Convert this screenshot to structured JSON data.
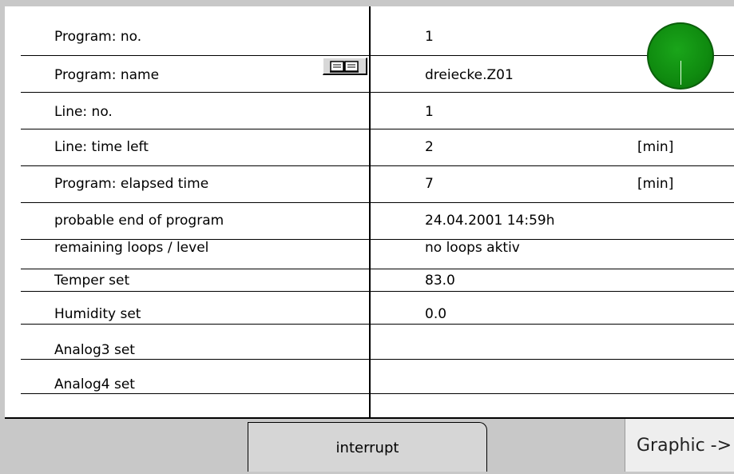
{
  "rows": [
    {
      "label": "Program: no.",
      "value": "1",
      "unit": ""
    },
    {
      "label": "Program: name",
      "value": "dreiecke.Z01",
      "unit": ""
    },
    {
      "label": "Line: no.",
      "value": "1",
      "unit": ""
    },
    {
      "label": "Line: time left",
      "value": "2",
      "unit": "[min]"
    },
    {
      "label": "Program: elapsed time",
      "value": "7",
      "unit": "[min]"
    },
    {
      "label": "probable end of program",
      "value": "24.04.2001 14:59h",
      "unit": ""
    },
    {
      "label": "remaining loops / level",
      "value": "no loops aktiv",
      "unit": ""
    },
    {
      "label": "Temper set",
      "value": "83.0",
      "unit": ""
    },
    {
      "label": "Humidity set",
      "value": "0.0",
      "unit": ""
    },
    {
      "label": "Analog3 set",
      "value": "",
      "unit": ""
    },
    {
      "label": "Analog4 set",
      "value": "",
      "unit": ""
    }
  ],
  "status_indicator": {
    "color": "#109010",
    "icon": "clock-status-icon"
  },
  "program_name_button": {
    "icon": "book-icon"
  },
  "buttons": {
    "interrupt": "interrupt",
    "graphic": "Graphic ->"
  }
}
